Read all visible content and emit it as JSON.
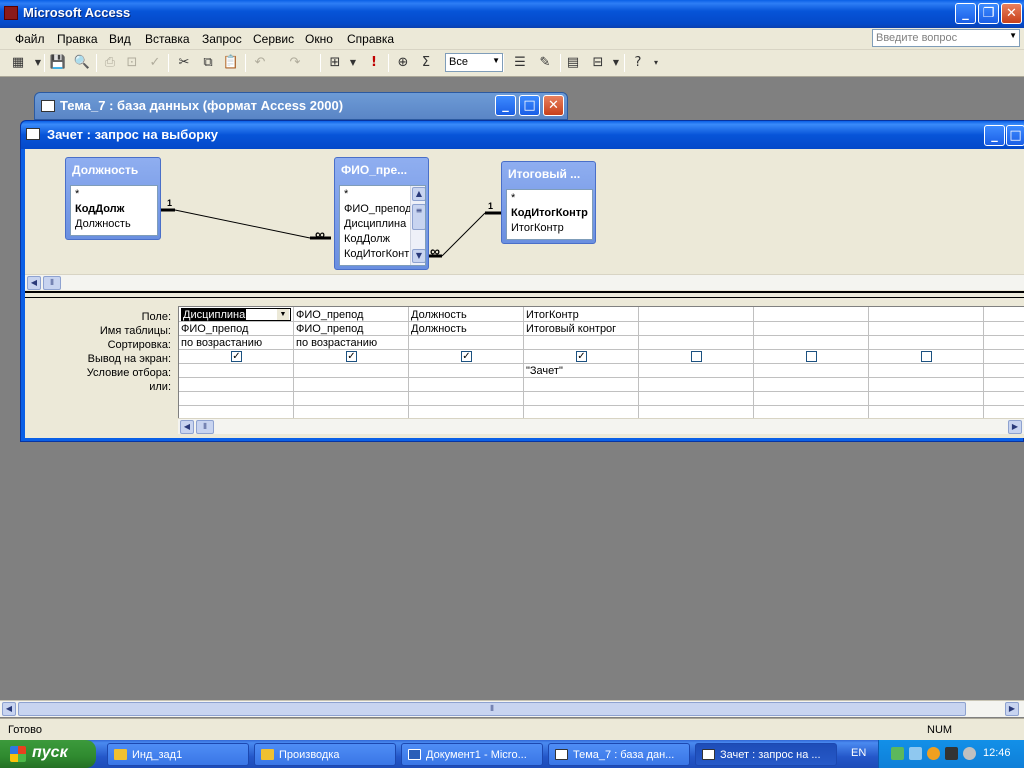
{
  "app": {
    "title": "Microsoft Access"
  },
  "menu": [
    "Файл",
    "Правка",
    "Вид",
    "Вставка",
    "Запрос",
    "Сервис",
    "Окно",
    "Справка"
  ],
  "ask_placeholder": "Введите вопрос",
  "toolbar": {
    "top_values": "Все",
    "sigma": "Σ",
    "exclaim": "!"
  },
  "db_window": {
    "title": "Тема_7 : база данных (формат Access 2000)"
  },
  "query_window": {
    "title": "Зачет : запрос на выборку"
  },
  "tables": [
    {
      "title": "Должность",
      "fields": [
        "*",
        "КодДолж",
        "Должность"
      ],
      "key": 1
    },
    {
      "title": "ФИО_пре...",
      "fields": [
        "*",
        "ФИО_препод",
        "Дисциплина",
        "КодДолж",
        "КодИтогКонт"
      ],
      "key": -1
    },
    {
      "title": "Итоговый ...",
      "fields": [
        "*",
        "КодИтогКонтр",
        "ИтогКонтр"
      ],
      "key": 1
    }
  ],
  "relations": {
    "one": "1",
    "many": "∞"
  },
  "grid": {
    "row_labels": [
      "Поле:",
      "Имя таблицы:",
      "Сортировка:",
      "Вывод на экран:",
      "Условие отбора:",
      "или:"
    ],
    "columns": [
      {
        "field": "Дисциплина",
        "table": "ФИО_препод",
        "sort": "по возрастанию",
        "show": true,
        "criteria": ""
      },
      {
        "field": "ФИО_препод",
        "table": "ФИО_препод",
        "sort": "по возрастанию",
        "show": true,
        "criteria": ""
      },
      {
        "field": "Должность",
        "table": "Должность",
        "sort": "",
        "show": true,
        "criteria": ""
      },
      {
        "field": "ИтогКонтр",
        "table": "Итоговый контрог",
        "sort": "",
        "show": true,
        "criteria": "\"Зачет\""
      },
      {
        "field": "",
        "table": "",
        "sort": "",
        "show": false,
        "criteria": ""
      },
      {
        "field": "",
        "table": "",
        "sort": "",
        "show": false,
        "criteria": ""
      },
      {
        "field": "",
        "table": "",
        "sort": "",
        "show": false,
        "criteria": ""
      },
      {
        "field": "",
        "table": "",
        "sort": "",
        "show": false,
        "criteria": ""
      }
    ]
  },
  "status": {
    "ready": "Готово",
    "num": "NUM"
  },
  "taskbar": {
    "start": "пуск",
    "tasks": [
      "Инд_зад1",
      "Производка",
      "Документ1 - Micro...",
      "Тема_7 : база дан...",
      "Зачет : запрос на ..."
    ],
    "active_task": 4,
    "lang": "EN",
    "clock": "12:46"
  }
}
